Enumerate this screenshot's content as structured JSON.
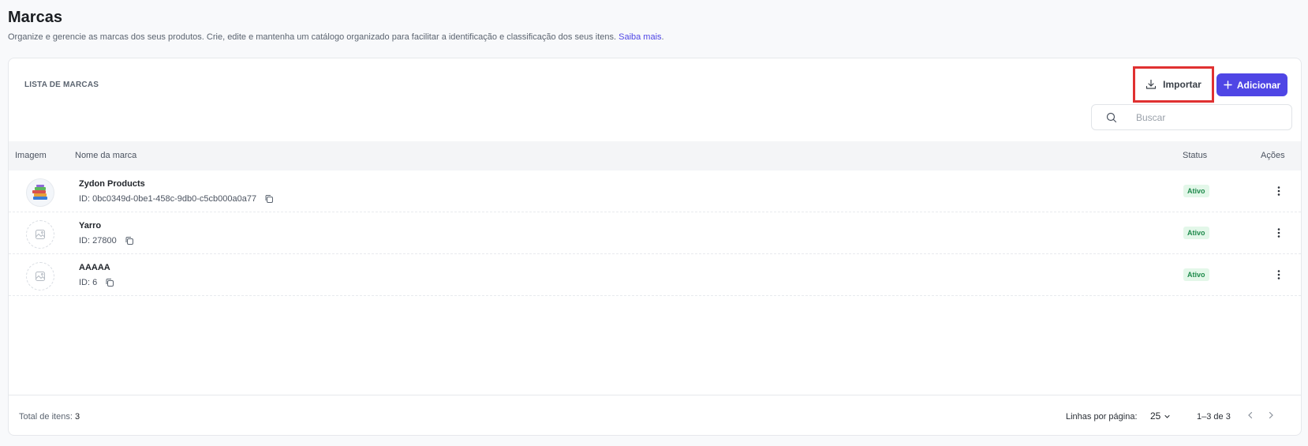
{
  "page": {
    "title": "Marcas",
    "description": "Organize e gerencie as marcas dos seus produtos. Crie, edite e mantenha um catálogo organizado para facilitar a identificação e classificação dos seus itens.",
    "learn_more": "Saiba mais",
    "period": "."
  },
  "card": {
    "label": "LISTA DE MARCAS",
    "import_label": "Importar",
    "add_label": "Adicionar",
    "search_placeholder": "Buscar"
  },
  "table": {
    "columns": {
      "image": "Imagem",
      "name": "Nome da marca",
      "status": "Status",
      "actions": "Ações"
    },
    "rows": [
      {
        "name": "Zydon Products",
        "id": "ID: 0bc0349d-0be1-458c-9db0-c5cb000a0a77",
        "status": "Ativo",
        "image": "books-logo"
      },
      {
        "name": "Yarro",
        "id": "ID: 27800",
        "status": "Ativo",
        "image": "placeholder-image-icon"
      },
      {
        "name": "AAAAA",
        "id": "ID: 6",
        "status": "Ativo",
        "image": "placeholder-image-icon"
      }
    ]
  },
  "footer": {
    "total_label": "Total de itens:",
    "total_value": "3",
    "rows_per_page_label": "Linhas por página:",
    "rows_per_page_value": "25",
    "range": "1–3 de 3"
  },
  "colors": {
    "accent": "#4f46e5",
    "status_bg": "#e3f7e9",
    "status_text": "#1f8a4c",
    "highlight": "#e03131"
  }
}
